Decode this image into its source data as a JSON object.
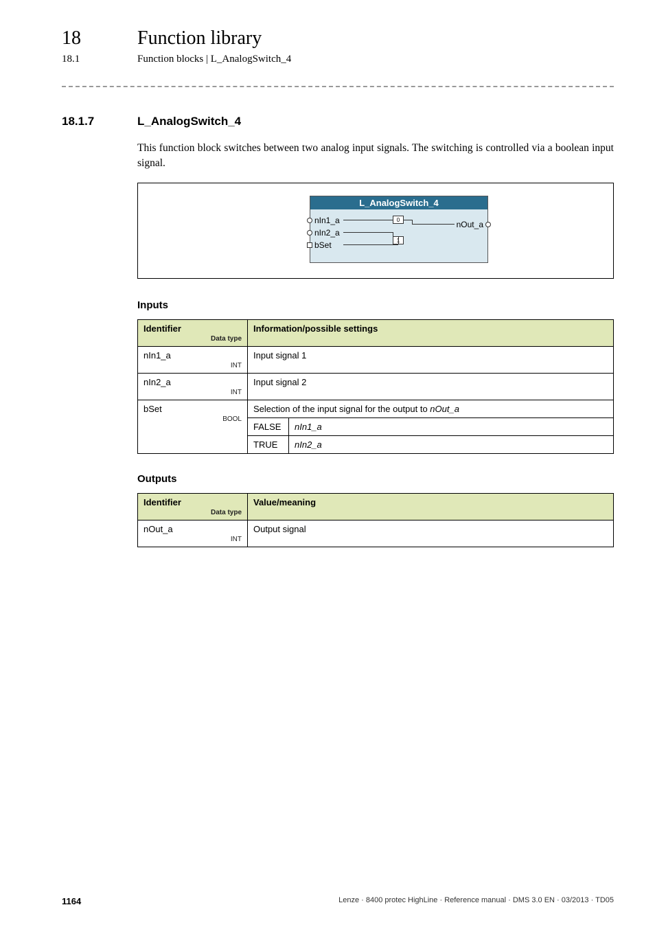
{
  "header": {
    "chapter_num": "18",
    "chapter_title": "Function library",
    "section_num": "18.1",
    "section_title": "Function blocks | L_AnalogSwitch_4"
  },
  "section": {
    "num": "18.1.7",
    "title": "L_AnalogSwitch_4",
    "description": "This function block switches between two analog input signals. The switching is controlled via a boolean input signal."
  },
  "diagram": {
    "block_title": "L_AnalogSwitch_4",
    "ports_in": [
      "nIn1_a",
      "nIn2_a",
      "bSet"
    ],
    "port_out": "nOut_a",
    "switch_labels": [
      "0",
      "1"
    ]
  },
  "inputs": {
    "heading": "Inputs",
    "header_col1": "Identifier",
    "header_col1_sub": "Data type",
    "header_col2": "Information/possible settings",
    "rows": [
      {
        "id": "nIn1_a",
        "dtype": "INT",
        "info": "Input signal 1"
      },
      {
        "id": "nIn2_a",
        "dtype": "INT",
        "info": "Input signal 2"
      },
      {
        "id": "bSet",
        "dtype": "BOOL",
        "info": "Selection of the input signal for the output to ",
        "info_ital": "nOut_a",
        "sub": [
          {
            "k": "FALSE",
            "v": "nIn1_a"
          },
          {
            "k": "TRUE",
            "v": "nIn2_a"
          }
        ]
      }
    ]
  },
  "outputs": {
    "heading": "Outputs",
    "header_col1": "Identifier",
    "header_col1_sub": "Data type",
    "header_col2": "Value/meaning",
    "rows": [
      {
        "id": "nOut_a",
        "dtype": "INT",
        "info": "Output signal"
      }
    ]
  },
  "footer": {
    "page": "1164",
    "info": "Lenze · 8400 protec HighLine · Reference manual · DMS 3.0 EN · 03/2013 · TD05"
  }
}
